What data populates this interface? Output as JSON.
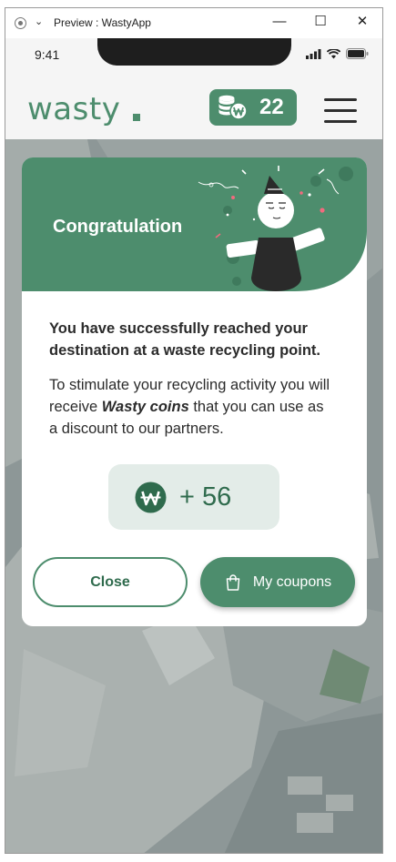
{
  "window": {
    "title": "Preview : WastyApp",
    "minimize_glyph": "—",
    "maximize_glyph": "☐",
    "close_glyph": "✕"
  },
  "status_bar": {
    "time": "9:41",
    "icons": [
      "signal-icon",
      "wifi-icon",
      "battery-icon"
    ]
  },
  "app_header": {
    "logo": "wasty",
    "coin_balance": "22",
    "icons": [
      "coin-stack-icon",
      "hamburger-menu-icon"
    ]
  },
  "modal": {
    "title": "Congratulation",
    "headline": "You have successfully reached your destination at a waste recycling point.",
    "body_prefix": "To stimulate your recycling activity you will receive ",
    "body_emphasis": "Wasty coins",
    "body_suffix": " that you can use as a discount to our partners.",
    "reward_amount": "+ 56",
    "close_label": "Close",
    "coupons_label": "My coupons",
    "icons": [
      "celebration-illustration",
      "coin-icon",
      "shopping-bag-icon"
    ]
  },
  "colors": {
    "accent": "#4d8d6d",
    "accent_dark": "#2f6b4d",
    "reward_bg": "#e3ece8",
    "text": "#2b2b2b"
  }
}
